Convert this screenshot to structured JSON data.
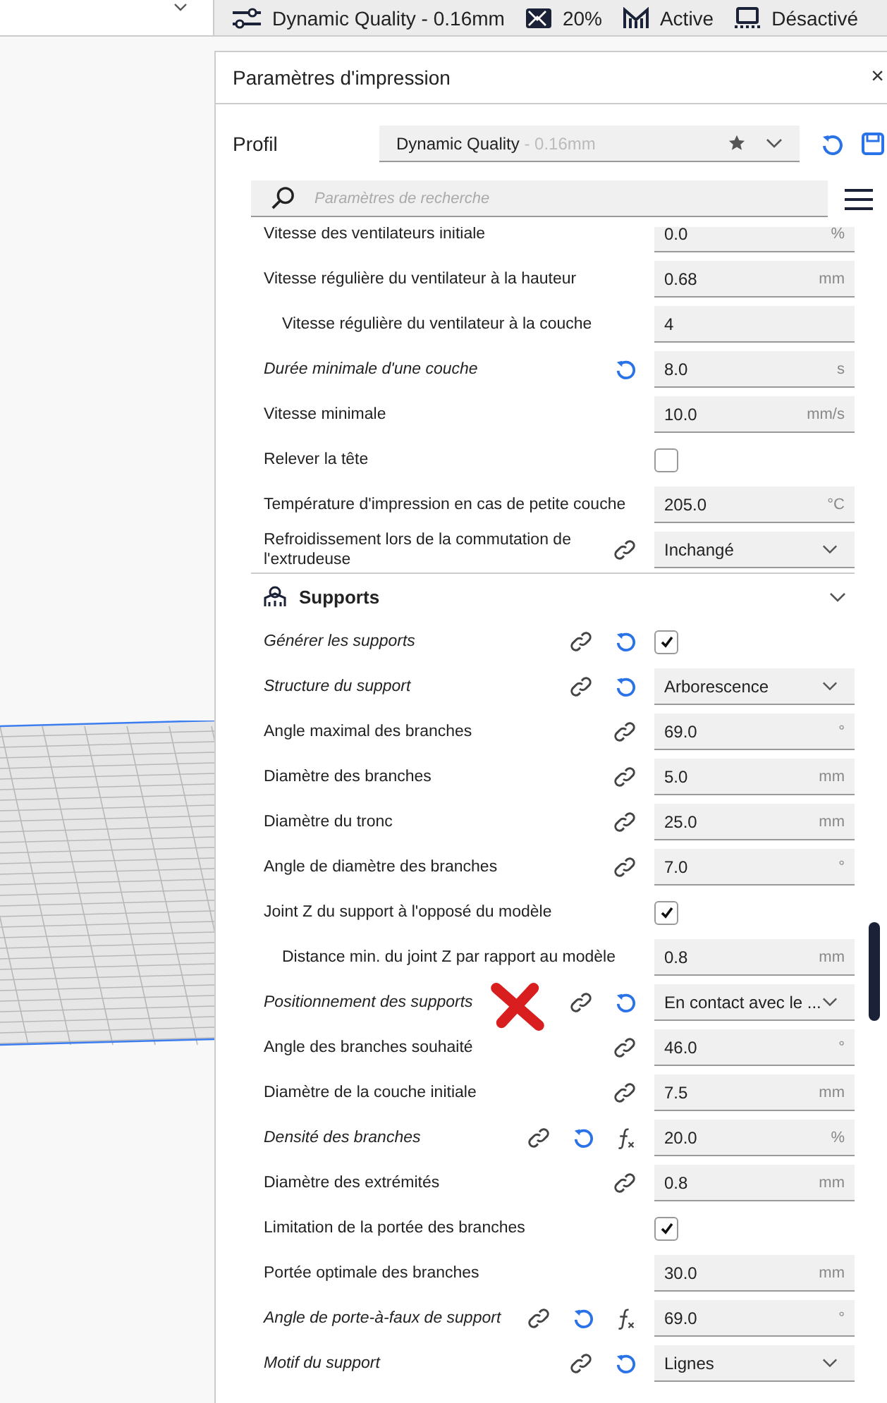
{
  "toolbar": {
    "items": [
      {
        "text": "Dynamic Quality - 0.16mm"
      },
      {
        "text": "20%"
      },
      {
        "text": "Active"
      },
      {
        "text": "Désactivé"
      }
    ]
  },
  "panel": {
    "title": "Paramètres d'impression",
    "close": "×",
    "profile": {
      "label": "Profil",
      "name": "Dynamic Quality",
      "detail": " - 0.16mm"
    },
    "search": {
      "placeholder": "Paramètres de recherche"
    },
    "rows": [
      {
        "kind": "number",
        "label": "Vitesse des ventilateurs initiale",
        "value": "0.0",
        "unit": "%",
        "modified": false,
        "linked": false
      },
      {
        "kind": "number",
        "label": "Vitesse régulière du ventilateur à la hauteur",
        "value": "0.68",
        "unit": "mm",
        "modified": false,
        "linked": false,
        "children": [
          {
            "kind": "number",
            "label": "Vitesse régulière du ventilateur à la couche",
            "value": "4",
            "modified": false,
            "linked": false
          }
        ]
      },
      {
        "kind": "number",
        "label": "Durée minimale d'une couche",
        "value": "8.0",
        "unit": "s",
        "modified": true,
        "linked": false
      },
      {
        "kind": "number",
        "label": "Vitesse minimale",
        "value": "10.0",
        "unit": "mm/s",
        "modified": false,
        "linked": false
      },
      {
        "kind": "check",
        "label": "Relever la tête",
        "checked": false,
        "modified": false,
        "linked": false
      },
      {
        "kind": "number",
        "label": "Température d'impression en cas de petite couche",
        "value": "205.0",
        "unit": "°C",
        "modified": false,
        "linked": false
      },
      {
        "kind": "select",
        "label": "Refroidissement lors de la commutation de l'extrudeuse",
        "value": "Inchangé",
        "modified": false,
        "linked": true
      },
      {
        "kind": "category",
        "label": "Supports",
        "expanded": true,
        "children": [
          {
            "kind": "check",
            "label": "Générer les supports",
            "checked": true,
            "modified": true,
            "linked": true
          },
          {
            "kind": "select",
            "label": "Structure du support",
            "value": "Arborescence",
            "modified": true,
            "linked": true
          },
          {
            "kind": "number",
            "label": "Angle maximal des branches",
            "value": "69.0",
            "unit": "°",
            "modified": false,
            "linked": true
          },
          {
            "kind": "number",
            "label": "Diamètre des branches",
            "value": "5.0",
            "unit": "mm",
            "modified": false,
            "linked": true
          },
          {
            "kind": "number",
            "label": "Diamètre du tronc",
            "value": "25.0",
            "unit": "mm",
            "modified": false,
            "linked": true
          },
          {
            "kind": "number",
            "label": "Angle de diamètre des branches",
            "value": "7.0",
            "unit": "°",
            "modified": false,
            "linked": true
          },
          {
            "kind": "check",
            "label": "Joint Z du support à l'opposé du modèle",
            "checked": true,
            "modified": false,
            "linked": false,
            "children": [
              {
                "kind": "number",
                "label": "Distance min. du joint Z par rapport au modèle",
                "value": "0.8",
                "unit": "mm",
                "modified": false,
                "linked": false
              }
            ]
          },
          {
            "kind": "select",
            "label": "Positionnement des supports",
            "value": "En contact avec le ...",
            "modified": true,
            "linked": true,
            "marked": true
          },
          {
            "kind": "number",
            "label": "Angle des branches souhaité",
            "value": "46.0",
            "unit": "°",
            "modified": false,
            "linked": true
          },
          {
            "kind": "number",
            "label": "Diamètre de la couche initiale",
            "value": "7.5",
            "unit": "mm",
            "modified": false,
            "linked": true
          },
          {
            "kind": "number",
            "label": "Densité des branches",
            "value": "20.0",
            "unit": "%",
            "modified": true,
            "linked": true,
            "formula": true
          },
          {
            "kind": "number",
            "label": "Diamètre des extrémités",
            "value": "0.8",
            "unit": "mm",
            "modified": false,
            "linked": true
          },
          {
            "kind": "check",
            "label": "Limitation de la portée des branches",
            "checked": true,
            "modified": false,
            "linked": false
          },
          {
            "kind": "number",
            "label": "Portée optimale des branches",
            "value": "30.0",
            "unit": "mm",
            "modified": false,
            "linked": false
          },
          {
            "kind": "number",
            "label": "Angle de porte-à-faux de support",
            "value": "69.0",
            "unit": "°",
            "modified": true,
            "linked": true,
            "formula": true
          },
          {
            "kind": "select",
            "label": "Motif du support",
            "value": "Lignes",
            "modified": true,
            "linked": true
          }
        ]
      }
    ]
  }
}
